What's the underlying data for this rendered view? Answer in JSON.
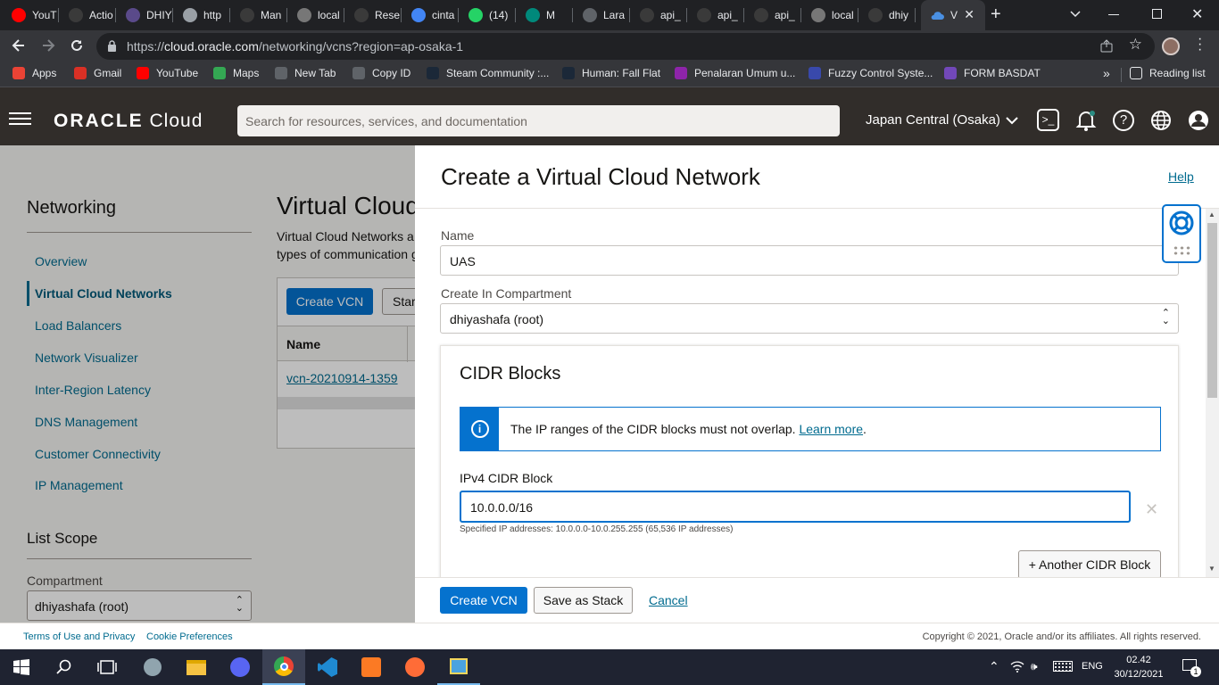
{
  "browser": {
    "tabs": [
      {
        "label": "YouT",
        "icon": "youtube-icon",
        "color": "#ff0000"
      },
      {
        "label": "Actio",
        "icon": "github-icon",
        "color": "#3a3a3a"
      },
      {
        "label": "DHIY",
        "icon": "site-icon",
        "color": "#5a4a8a"
      },
      {
        "label": "http",
        "icon": "page-icon",
        "color": "#9aa0a6"
      },
      {
        "label": "Man",
        "icon": "github-icon",
        "color": "#3a3a3a"
      },
      {
        "label": "local",
        "icon": "xampp-icon",
        "color": "#777"
      },
      {
        "label": "Rese",
        "icon": "github-icon",
        "color": "#3a3a3a"
      },
      {
        "label": "cinta",
        "icon": "google-icon",
        "color": "#4285f4"
      },
      {
        "label": "(14)",
        "icon": "whatsapp-icon",
        "color": "#25d366"
      },
      {
        "label": "M",
        "icon": "meet-icon",
        "color": "#00897b"
      },
      {
        "label": "Lara",
        "icon": "web-icon",
        "color": "#5f6368"
      },
      {
        "label": "api_",
        "icon": "github-icon",
        "color": "#3a3a3a"
      },
      {
        "label": "api_",
        "icon": "github-icon",
        "color": "#3a3a3a"
      },
      {
        "label": "api_",
        "icon": "github-icon",
        "color": "#3a3a3a"
      },
      {
        "label": "local",
        "icon": "xampp-icon",
        "color": "#777"
      },
      {
        "label": "dhiy",
        "icon": "github-icon",
        "color": "#3a3a3a"
      }
    ],
    "active_tab": {
      "label": "V",
      "icon": "oracle-cloud-icon"
    },
    "url_prefix": "https://",
    "url_host": "cloud.oracle.com",
    "url_path": "/networking/vcns?region=ap-osaka-1",
    "bookmarks": [
      {
        "label": "Apps",
        "icon": "apps-grid-icon",
        "color": "#ea4335"
      },
      {
        "label": "Gmail",
        "icon": "gmail-icon",
        "color": "#d93025"
      },
      {
        "label": "YouTube",
        "icon": "youtube-icon",
        "color": "#ff0000"
      },
      {
        "label": "Maps",
        "icon": "maps-icon",
        "color": "#34a853"
      },
      {
        "label": "New Tab",
        "icon": "globe-icon",
        "color": "#5f6368"
      },
      {
        "label": "Copy ID",
        "icon": "globe-icon",
        "color": "#5f6368"
      },
      {
        "label": "Steam Community :...",
        "icon": "steam-icon",
        "color": "#1b2838"
      },
      {
        "label": "Human: Fall Flat",
        "icon": "steam-icon",
        "color": "#1b2838"
      },
      {
        "label": "Penalaran Umum u...",
        "icon": "z-icon",
        "color": "#8e24aa"
      },
      {
        "label": "Fuzzy Control Syste...",
        "icon": "f-icon",
        "color": "#3949ab"
      },
      {
        "label": "FORM BASDAT",
        "icon": "forms-icon",
        "color": "#7248b9"
      }
    ],
    "reading_list": "Reading list"
  },
  "header": {
    "brand": "ORACLE",
    "brand_suffix": "Cloud",
    "search_placeholder": "Search for resources, services, and documentation",
    "region": "Japan Central (Osaka)"
  },
  "sidebar": {
    "title": "Networking",
    "items": [
      {
        "label": "Overview",
        "active": false
      },
      {
        "label": "Virtual Cloud Networks",
        "active": true
      },
      {
        "label": "Load Balancers",
        "active": false
      },
      {
        "label": "Network Visualizer",
        "active": false
      },
      {
        "label": "Inter-Region Latency",
        "active": false
      },
      {
        "label": "DNS Management",
        "active": false
      },
      {
        "label": "Customer Connectivity",
        "active": false
      },
      {
        "label": "IP Management",
        "active": false
      }
    ],
    "scope_title": "List Scope",
    "compartment_label": "Compartment",
    "compartment_value": "dhiyashafa (root)"
  },
  "main": {
    "title": "Virtual Cloud",
    "desc_line1": "Virtual Cloud Networks a",
    "desc_line2": "types of communication g",
    "create_button": "Create VCN",
    "start_button": "Star",
    "col_name": "Name",
    "row_vcn": "vcn-20210914-1359"
  },
  "panel": {
    "title": "Create a Virtual Cloud Network",
    "help": "Help",
    "name_label": "Name",
    "name_value": "UAS",
    "compartment_label": "Create In Compartment",
    "compartment_value": "dhiyashafa (root)",
    "cidr_title": "CIDR Blocks",
    "info_text": "The IP ranges of the CIDR blocks must not overlap.",
    "info_link": "Learn more",
    "info_end": ".",
    "ipv4_label": "IPv4 CIDR Block",
    "ipv4_value": "10.0.0.0/16",
    "ipv4_hint": "Specified IP addresses: 10.0.0.0-10.0.255.255 (65,536 IP addresses)",
    "another_cidr": "+ Another CIDR Block",
    "create_button": "Create VCN",
    "save_stack_button": "Save as Stack",
    "cancel": "Cancel"
  },
  "footer": {
    "terms": "Terms of Use and Privacy",
    "cookies": "Cookie Preferences",
    "copyright": "Copyright © 2021, Oracle and/or its affiliates. All rights reserved."
  },
  "taskbar": {
    "lang": "ENG",
    "time": "02.42",
    "date": "30/12/2021",
    "notifications": "1"
  },
  "colors": {
    "oracle_header": "#312d2a",
    "primary_button": "#0572ce",
    "link": "#006b8f",
    "info_accent": "#0572ce"
  }
}
